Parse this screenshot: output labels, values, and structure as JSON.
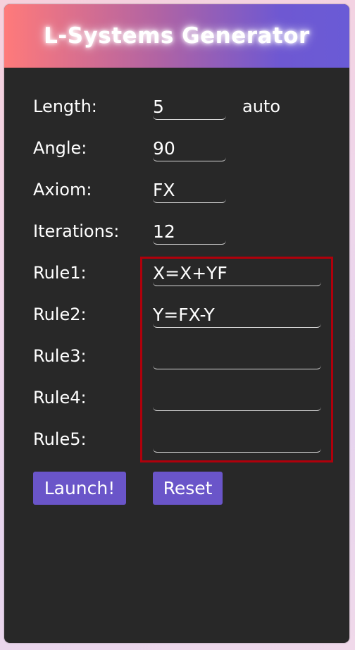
{
  "header": {
    "title": "L-Systems Generator"
  },
  "form": {
    "length": {
      "label": "Length:",
      "value": "5",
      "suffix": "auto"
    },
    "angle": {
      "label": "Angle:",
      "value": "90"
    },
    "axiom": {
      "label": "Axiom:",
      "value": "FX"
    },
    "iterations": {
      "label": "Iterations:",
      "value": "12"
    },
    "rules": [
      {
        "label": "Rule1:",
        "value": "X=X+YF"
      },
      {
        "label": "Rule2:",
        "value": "Y=FX-Y"
      },
      {
        "label": "Rule3:",
        "value": ""
      },
      {
        "label": "Rule4:",
        "value": ""
      },
      {
        "label": "Rule5:",
        "value": ""
      }
    ]
  },
  "buttons": {
    "launch_label": "Launch!",
    "reset_label": "Reset"
  },
  "colors": {
    "panel_bg": "#282828",
    "button_bg": "#6a55c9",
    "highlight_border": "#b0000b",
    "header_gradient_start": "#ff7a7a",
    "header_gradient_end": "#6a5bd6"
  }
}
